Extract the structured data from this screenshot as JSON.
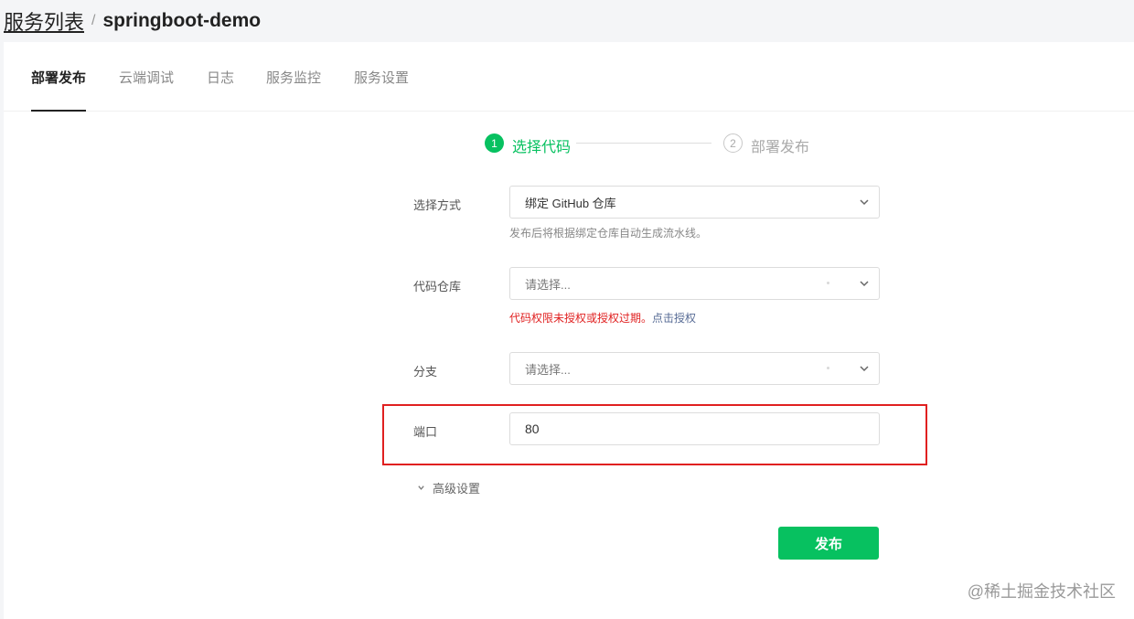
{
  "breadcrumb": {
    "parent": "服务列表",
    "separator": "/",
    "current": "springboot-demo"
  },
  "tabs": [
    {
      "label": "部署发布",
      "active": true
    },
    {
      "label": "云端调试",
      "active": false
    },
    {
      "label": "日志",
      "active": false
    },
    {
      "label": "服务监控",
      "active": false
    },
    {
      "label": "服务设置",
      "active": false
    }
  ],
  "steps": [
    {
      "number": "1",
      "label": "选择代码",
      "state": "active"
    },
    {
      "number": "2",
      "label": "部署发布",
      "state": "pending"
    }
  ],
  "form": {
    "method": {
      "label": "选择方式",
      "value": "绑定 GitHub 仓库",
      "hint": "发布后将根据绑定仓库自动生成流水线。"
    },
    "repo": {
      "label": "代码仓库",
      "placeholder": "请选择...",
      "error_text": "代码权限未授权或授权过期。",
      "error_link": "点击授权"
    },
    "branch": {
      "label": "分支",
      "placeholder": "请选择..."
    },
    "port": {
      "label": "端口",
      "value": "80"
    },
    "advanced_label": "高级设置",
    "submit_label": "发布"
  },
  "watermark": "@稀土掘金技术社区",
  "colors": {
    "accent": "#07c160",
    "error": "#e02020",
    "link": "#576b95"
  }
}
